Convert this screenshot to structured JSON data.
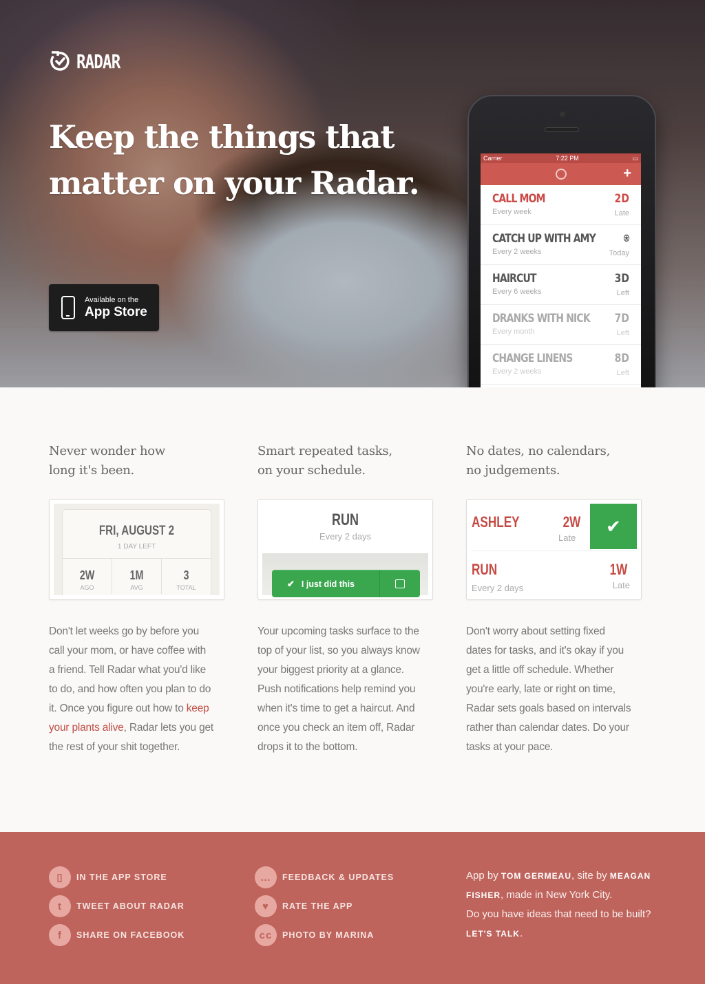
{
  "brand": {
    "name": "RADAR",
    "logo_icon": "radar-check-icon"
  },
  "hero": {
    "headline": "Keep the things that matter on your Radar.",
    "appstore_small": "Available on the",
    "appstore_large": "App Store"
  },
  "phone": {
    "carrier": "Carrier",
    "time": "7:22 PM",
    "add_label": "+",
    "tasks": [
      {
        "name": "CALL MOM",
        "freq": "Every week",
        "amount": "2D",
        "status": "Late"
      },
      {
        "name": "CATCH UP WITH AMY",
        "freq": "Every 2 weeks",
        "amount": "⍟",
        "status": "Today"
      },
      {
        "name": "HAIRCUT",
        "freq": "Every 6 weeks",
        "amount": "3D",
        "status": "Left"
      },
      {
        "name": "DRANKS WITH NICK",
        "freq": "Every month",
        "amount": "7D",
        "status": "Left"
      },
      {
        "name": "CHANGE LINENS",
        "freq": "Every 2 weeks",
        "amount": "8D",
        "status": "Left"
      }
    ]
  },
  "features": [
    {
      "title_line1": "Never wonder how",
      "title_line2": "long it's been.",
      "body_pre": "Don't let weeks go by before you call your mom, or have coffee with a friend. Tell Radar what you'd like to do, and how often you plan to do it. Once you figure out how to ",
      "body_link": "keep your plants alive",
      "body_post": ", Radar lets you get the rest of your shit together."
    },
    {
      "title_line1": "Smart repeated tasks,",
      "title_line2": "on your schedule.",
      "body": "Your upcoming tasks surface to the top of your list, so you always know your biggest priority at a glance. Push notifications help remind you when it's time to get a haircut. And once you check an item off, Radar drops it to the bottom."
    },
    {
      "title_line1": "No dates, no calendars,",
      "title_line2": "no judgements.",
      "body": "Don't worry about setting fixed dates for tasks, and it's okay if you get a little off schedule. Whether you're early, late or right on time, Radar sets goals based on intervals rather than calendar dates. Do your tasks at your pace."
    }
  ],
  "card1": {
    "date": "FRI, AUGUST 2",
    "left": "1 DAY LEFT",
    "stats": [
      {
        "value": "2W",
        "label": "AGO"
      },
      {
        "value": "1M",
        "label": "AVG"
      },
      {
        "value": "3",
        "label": "TOTAL"
      }
    ]
  },
  "card2": {
    "name": "RUN",
    "freq": "Every 2 days",
    "button": "I just did this"
  },
  "card3": {
    "row1": {
      "name": "ASHLEY",
      "amount": "2W",
      "status": "Late"
    },
    "row2": {
      "name": "RUN",
      "freq": "Every 2 days",
      "amount": "1W",
      "status": "Late"
    }
  },
  "footer": {
    "links": [
      {
        "label": "IN THE APP STORE",
        "icon": "phone-icon"
      },
      {
        "label": "TWEET ABOUT RADAR",
        "icon": "twitter-icon"
      },
      {
        "label": "SHARE ON FACEBOOK",
        "icon": "facebook-icon"
      },
      {
        "label": "FEEDBACK & UPDATES",
        "icon": "chat-icon"
      },
      {
        "label": "RATE THE APP",
        "icon": "heart-icon"
      },
      {
        "label": "PHOTO BY MARINA",
        "icon": "creative-commons-icon"
      }
    ],
    "credit": {
      "app_by": "App by ",
      "author1": "TOM GERMEAU",
      "site_by": ", site by ",
      "author2": "MEAGAN FISHER",
      "made_in": ", made in New York City.",
      "question": "Do you have ideas that need to be built?",
      "cta": "LET'S TALK",
      "period": "."
    }
  },
  "colors": {
    "accent": "#cc4a45",
    "footer": "#bf645d",
    "green": "#3aa74f"
  }
}
